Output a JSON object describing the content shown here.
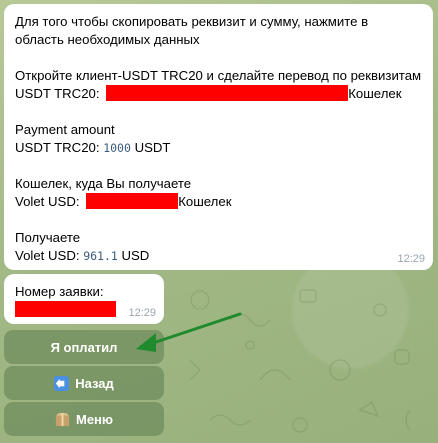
{
  "message_main": {
    "line1": "Для того чтобы скопировать реквизит и сумму, нажмите в",
    "line2": "область необходимых данных",
    "line3": "Откройте клиент-USDT TRC20 и сделайте перевод по реквизитам",
    "line4_prefix": "USDT TRC20:",
    "line4_suffix": "Кошелек",
    "line5": "Payment amount",
    "line6_prefix": "USDT TRC20:",
    "line6_amount": "1000",
    "line6_suffix": "USDT",
    "line7": "Кошелек, куда Вы получаете",
    "line8_prefix": "Volet USD:",
    "line8_suffix": "Кошелек",
    "line9": "Получаете",
    "line10_prefix": "Volet USD:",
    "line10_amount": "961.1",
    "line10_suffix": "USD",
    "time": "12:29"
  },
  "message_order": {
    "label": "Номер заявки:",
    "time": "12:29"
  },
  "keyboard": {
    "paid_label": "Я оплатил",
    "back_label": "Назад",
    "menu_label": "Меню"
  },
  "colors": {
    "redaction": "#ff0000",
    "arrow": "#1f8a2e",
    "button_bg": "#5f7d50"
  }
}
